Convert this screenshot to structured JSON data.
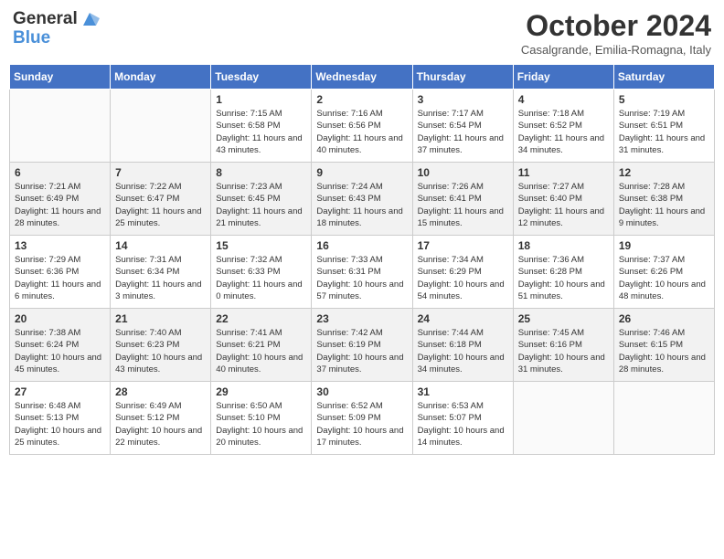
{
  "header": {
    "logo_line1": "General",
    "logo_line2": "Blue",
    "month_title": "October 2024",
    "location": "Casalgrande, Emilia-Romagna, Italy"
  },
  "days_of_week": [
    "Sunday",
    "Monday",
    "Tuesday",
    "Wednesday",
    "Thursday",
    "Friday",
    "Saturday"
  ],
  "weeks": [
    [
      {
        "day": "",
        "sunrise": "",
        "sunset": "",
        "daylight": "",
        "empty": true
      },
      {
        "day": "",
        "sunrise": "",
        "sunset": "",
        "daylight": "",
        "empty": true
      },
      {
        "day": "1",
        "sunrise": "Sunrise: 7:15 AM",
        "sunset": "Sunset: 6:58 PM",
        "daylight": "Daylight: 11 hours and 43 minutes.",
        "empty": false
      },
      {
        "day": "2",
        "sunrise": "Sunrise: 7:16 AM",
        "sunset": "Sunset: 6:56 PM",
        "daylight": "Daylight: 11 hours and 40 minutes.",
        "empty": false
      },
      {
        "day": "3",
        "sunrise": "Sunrise: 7:17 AM",
        "sunset": "Sunset: 6:54 PM",
        "daylight": "Daylight: 11 hours and 37 minutes.",
        "empty": false
      },
      {
        "day": "4",
        "sunrise": "Sunrise: 7:18 AM",
        "sunset": "Sunset: 6:52 PM",
        "daylight": "Daylight: 11 hours and 34 minutes.",
        "empty": false
      },
      {
        "day": "5",
        "sunrise": "Sunrise: 7:19 AM",
        "sunset": "Sunset: 6:51 PM",
        "daylight": "Daylight: 11 hours and 31 minutes.",
        "empty": false
      }
    ],
    [
      {
        "day": "6",
        "sunrise": "Sunrise: 7:21 AM",
        "sunset": "Sunset: 6:49 PM",
        "daylight": "Daylight: 11 hours and 28 minutes.",
        "empty": false
      },
      {
        "day": "7",
        "sunrise": "Sunrise: 7:22 AM",
        "sunset": "Sunset: 6:47 PM",
        "daylight": "Daylight: 11 hours and 25 minutes.",
        "empty": false
      },
      {
        "day": "8",
        "sunrise": "Sunrise: 7:23 AM",
        "sunset": "Sunset: 6:45 PM",
        "daylight": "Daylight: 11 hours and 21 minutes.",
        "empty": false
      },
      {
        "day": "9",
        "sunrise": "Sunrise: 7:24 AM",
        "sunset": "Sunset: 6:43 PM",
        "daylight": "Daylight: 11 hours and 18 minutes.",
        "empty": false
      },
      {
        "day": "10",
        "sunrise": "Sunrise: 7:26 AM",
        "sunset": "Sunset: 6:41 PM",
        "daylight": "Daylight: 11 hours and 15 minutes.",
        "empty": false
      },
      {
        "day": "11",
        "sunrise": "Sunrise: 7:27 AM",
        "sunset": "Sunset: 6:40 PM",
        "daylight": "Daylight: 11 hours and 12 minutes.",
        "empty": false
      },
      {
        "day": "12",
        "sunrise": "Sunrise: 7:28 AM",
        "sunset": "Sunset: 6:38 PM",
        "daylight": "Daylight: 11 hours and 9 minutes.",
        "empty": false
      }
    ],
    [
      {
        "day": "13",
        "sunrise": "Sunrise: 7:29 AM",
        "sunset": "Sunset: 6:36 PM",
        "daylight": "Daylight: 11 hours and 6 minutes.",
        "empty": false
      },
      {
        "day": "14",
        "sunrise": "Sunrise: 7:31 AM",
        "sunset": "Sunset: 6:34 PM",
        "daylight": "Daylight: 11 hours and 3 minutes.",
        "empty": false
      },
      {
        "day": "15",
        "sunrise": "Sunrise: 7:32 AM",
        "sunset": "Sunset: 6:33 PM",
        "daylight": "Daylight: 11 hours and 0 minutes.",
        "empty": false
      },
      {
        "day": "16",
        "sunrise": "Sunrise: 7:33 AM",
        "sunset": "Sunset: 6:31 PM",
        "daylight": "Daylight: 10 hours and 57 minutes.",
        "empty": false
      },
      {
        "day": "17",
        "sunrise": "Sunrise: 7:34 AM",
        "sunset": "Sunset: 6:29 PM",
        "daylight": "Daylight: 10 hours and 54 minutes.",
        "empty": false
      },
      {
        "day": "18",
        "sunrise": "Sunrise: 7:36 AM",
        "sunset": "Sunset: 6:28 PM",
        "daylight": "Daylight: 10 hours and 51 minutes.",
        "empty": false
      },
      {
        "day": "19",
        "sunrise": "Sunrise: 7:37 AM",
        "sunset": "Sunset: 6:26 PM",
        "daylight": "Daylight: 10 hours and 48 minutes.",
        "empty": false
      }
    ],
    [
      {
        "day": "20",
        "sunrise": "Sunrise: 7:38 AM",
        "sunset": "Sunset: 6:24 PM",
        "daylight": "Daylight: 10 hours and 45 minutes.",
        "empty": false
      },
      {
        "day": "21",
        "sunrise": "Sunrise: 7:40 AM",
        "sunset": "Sunset: 6:23 PM",
        "daylight": "Daylight: 10 hours and 43 minutes.",
        "empty": false
      },
      {
        "day": "22",
        "sunrise": "Sunrise: 7:41 AM",
        "sunset": "Sunset: 6:21 PM",
        "daylight": "Daylight: 10 hours and 40 minutes.",
        "empty": false
      },
      {
        "day": "23",
        "sunrise": "Sunrise: 7:42 AM",
        "sunset": "Sunset: 6:19 PM",
        "daylight": "Daylight: 10 hours and 37 minutes.",
        "empty": false
      },
      {
        "day": "24",
        "sunrise": "Sunrise: 7:44 AM",
        "sunset": "Sunset: 6:18 PM",
        "daylight": "Daylight: 10 hours and 34 minutes.",
        "empty": false
      },
      {
        "day": "25",
        "sunrise": "Sunrise: 7:45 AM",
        "sunset": "Sunset: 6:16 PM",
        "daylight": "Daylight: 10 hours and 31 minutes.",
        "empty": false
      },
      {
        "day": "26",
        "sunrise": "Sunrise: 7:46 AM",
        "sunset": "Sunset: 6:15 PM",
        "daylight": "Daylight: 10 hours and 28 minutes.",
        "empty": false
      }
    ],
    [
      {
        "day": "27",
        "sunrise": "Sunrise: 6:48 AM",
        "sunset": "Sunset: 5:13 PM",
        "daylight": "Daylight: 10 hours and 25 minutes.",
        "empty": false
      },
      {
        "day": "28",
        "sunrise": "Sunrise: 6:49 AM",
        "sunset": "Sunset: 5:12 PM",
        "daylight": "Daylight: 10 hours and 22 minutes.",
        "empty": false
      },
      {
        "day": "29",
        "sunrise": "Sunrise: 6:50 AM",
        "sunset": "Sunset: 5:10 PM",
        "daylight": "Daylight: 10 hours and 20 minutes.",
        "empty": false
      },
      {
        "day": "30",
        "sunrise": "Sunrise: 6:52 AM",
        "sunset": "Sunset: 5:09 PM",
        "daylight": "Daylight: 10 hours and 17 minutes.",
        "empty": false
      },
      {
        "day": "31",
        "sunrise": "Sunrise: 6:53 AM",
        "sunset": "Sunset: 5:07 PM",
        "daylight": "Daylight: 10 hours and 14 minutes.",
        "empty": false
      },
      {
        "day": "",
        "sunrise": "",
        "sunset": "",
        "daylight": "",
        "empty": true
      },
      {
        "day": "",
        "sunrise": "",
        "sunset": "",
        "daylight": "",
        "empty": true
      }
    ]
  ]
}
